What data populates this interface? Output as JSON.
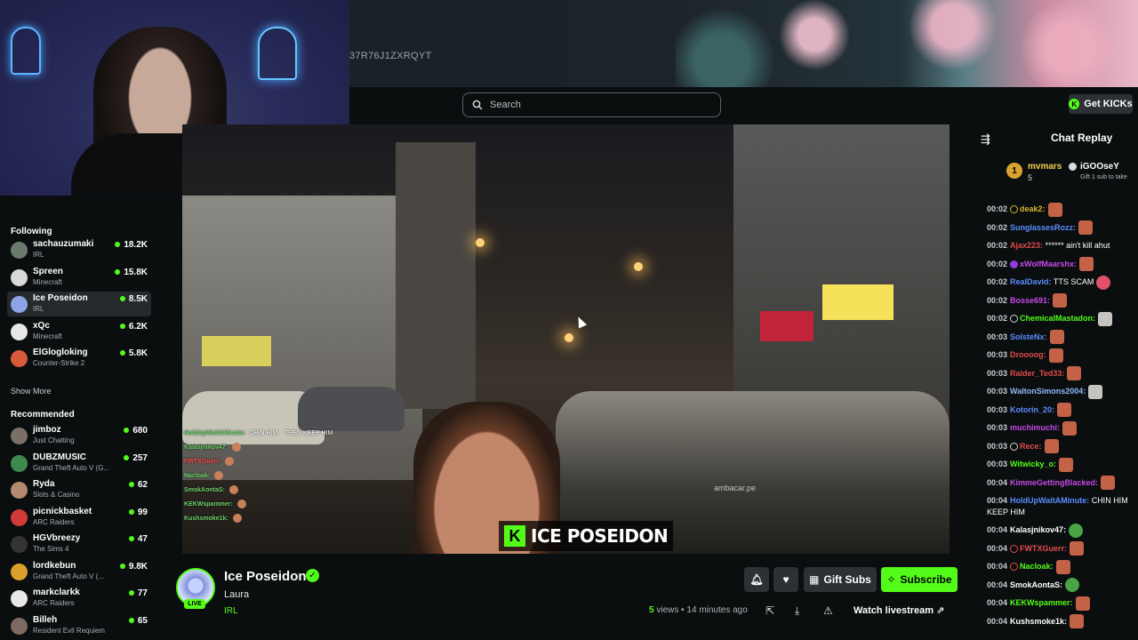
{
  "banner": {
    "code": "37R76J1ZXRQYT"
  },
  "header": {
    "search_placeholder": "Search",
    "get_kicks": "Get KICKs"
  },
  "sidebar": {
    "following_title": "Following",
    "following": [
      {
        "name": "sachauzumaki",
        "category": "IRL",
        "viewers": "18.2K",
        "avatar_color": "#6b7a6f"
      },
      {
        "name": "Spreen",
        "category": "Minecraft",
        "viewers": "15.8K",
        "avatar_color": "#d9d9d9"
      },
      {
        "name": "Ice Poseidon",
        "category": "IRL",
        "viewers": "8.5K",
        "avatar_color": "#8da4e8"
      },
      {
        "name": "xQc",
        "category": "Minecraft",
        "viewers": "6.2K",
        "avatar_color": "#e8e8e8"
      },
      {
        "name": "ElGlogloking",
        "category": "Counter-Strike 2",
        "viewers": "5.8K",
        "avatar_color": "#d85a3b"
      }
    ],
    "show_more": "Show More",
    "recommended_title": "Recommended",
    "recommended": [
      {
        "name": "jimboz",
        "category": "Just Chatting",
        "viewers": "680",
        "avatar_color": "#7a7068"
      },
      {
        "name": "DUBZMUSIC",
        "category": "Grand Theft Auto V (G...",
        "viewers": "257",
        "avatar_color": "#3e8a4e"
      },
      {
        "name": "Ryda",
        "category": "Slots & Casino",
        "viewers": "62",
        "avatar_color": "#b38a6d"
      },
      {
        "name": "picnickbasket",
        "category": "ARC Raiders",
        "viewers": "99",
        "avatar_color": "#d23a3a"
      },
      {
        "name": "HGVbreezy",
        "category": "The Sims 4",
        "viewers": "47",
        "avatar_color": "#333"
      },
      {
        "name": "lordkebun",
        "category": "Grand Theft Auto V (...",
        "viewers": "9.8K",
        "avatar_color": "#d9a12b"
      },
      {
        "name": "markclarkk",
        "category": "ARC Raiders",
        "viewers": "77",
        "avatar_color": "#e8e8e8"
      },
      {
        "name": "Billeh",
        "category": "Resident Evil Requiem",
        "viewers": "65",
        "avatar_color": "#7d6a60"
      }
    ]
  },
  "video": {
    "watermark": "ICE POSEIDON",
    "car_watermark": "ambacar.pe",
    "overlay_chat": [
      {
        "user": "HoldUpWaitAMinute:",
        "msg": "CHIN HIM",
        "extra_user": "",
        "extra_msg": "THEN KEEP HIM",
        "red": false
      },
      {
        "user": "Kalasjnikov47:",
        "msg": "",
        "red": false
      },
      {
        "user": "FWTXGuerr:",
        "msg": "",
        "red": true
      },
      {
        "user": "Nacloak:",
        "msg": "",
        "red": false
      },
      {
        "user": "SmokAontaS:",
        "msg": "",
        "red": false
      },
      {
        "user": "KEKWspammer:",
        "msg": "",
        "red": false
      },
      {
        "user": "Kushsmoke1k:",
        "msg": "",
        "red": false
      }
    ]
  },
  "info": {
    "channel_name": "Ice Poseidon",
    "live_badge": "LIVE",
    "title": "Laura",
    "category": "IRL",
    "gift_subs": "Gift Subs",
    "subscribe": "Subscribe",
    "views_count": "5",
    "views_label": "views",
    "age": "• 14 minutes ago",
    "watch_livestream": "Watch livestream"
  },
  "chat": {
    "title": "Chat Replay",
    "pinned": {
      "rank": "1",
      "user1": "mvmars",
      "count": "5",
      "user2": "iGOOseY",
      "gift_text": "Gift 1 sub to take"
    },
    "messages": [
      {
        "time": "00:02",
        "badge": "y",
        "user": "deak2:",
        "color": "#d8b42c",
        "text": "",
        "emote": "r"
      },
      {
        "time": "00:02",
        "badge": "",
        "user": "SunglassesRozz:",
        "color": "#5b8cff",
        "text": "",
        "emote": "r"
      },
      {
        "time": "00:02",
        "badge": "",
        "user": "Ajax223:",
        "color": "#e24a4a",
        "text": "****** ain't kill ahut",
        "emote": ""
      },
      {
        "time": "00:02",
        "badge": "p",
        "user": "xWolfMaarshx:",
        "color": "#c44be8",
        "text": "",
        "emote": "r"
      },
      {
        "time": "00:02",
        "badge": "",
        "user": "RealDavid:",
        "color": "#5b8cff",
        "text": "TTS SCAM",
        "emote": "pk"
      },
      {
        "time": "00:02",
        "badge": "",
        "user": "Bosse691:",
        "color": "#c44be8",
        "text": "",
        "emote": "r"
      },
      {
        "time": "00:02",
        "badge": "w",
        "user": "ChemicalMastadon:",
        "color": "#53fc18",
        "text": "",
        "emote": "c"
      },
      {
        "time": "00:03",
        "badge": "",
        "user": "SolsteNx:",
        "color": "#5b8cff",
        "text": "",
        "emote": "r"
      },
      {
        "time": "00:03",
        "badge": "",
        "user": "Droooog:",
        "color": "#e24a4a",
        "text": "",
        "emote": "r"
      },
      {
        "time": "00:03",
        "badge": "",
        "user": "Raider_Ted33:",
        "color": "#e24a4a",
        "text": "",
        "emote": "r"
      },
      {
        "time": "00:03",
        "badge": "",
        "user": "WaltonSimons2004:",
        "color": "#8fb8ff",
        "text": "",
        "emote": "c"
      },
      {
        "time": "00:03",
        "badge": "",
        "user": "Kotorin_20:",
        "color": "#5b8cff",
        "text": "",
        "emote": "r"
      },
      {
        "time": "00:03",
        "badge": "",
        "user": "muchimuchi:",
        "color": "#c44be8",
        "text": "",
        "emote": "r"
      },
      {
        "time": "00:03",
        "badge": "w",
        "user": "Rece:",
        "color": "#e24a4a",
        "text": "",
        "emote": "r"
      },
      {
        "time": "00:03",
        "badge": "",
        "user": "Witwicky_o:",
        "color": "#53fc18",
        "text": "",
        "emote": "r"
      },
      {
        "time": "00:04",
        "badge": "",
        "user": "KimmeGettingBlacked:",
        "color": "#c44be8",
        "text": "",
        "emote": "r"
      },
      {
        "time": "00:04",
        "badge": "",
        "user": "HoldUpWaitAMinute:",
        "color": "#5b8cff",
        "text": "CHIN HIM KEEP HIM",
        "emote": "",
        "wrap": true
      },
      {
        "time": "00:04",
        "badge": "",
        "user": "Kalasjnikov47:",
        "color": "#ffffff",
        "text": "",
        "emote": "g"
      },
      {
        "time": "00:04",
        "badge": "r",
        "user": "FWTXGuerr:",
        "color": "#e24a4a",
        "text": "",
        "emote": "r"
      },
      {
        "time": "00:04",
        "badge": "r",
        "user": "Nacloak:",
        "color": "#53fc18",
        "text": "",
        "emote": "r"
      },
      {
        "time": "00:04",
        "badge": "",
        "user": "SmokAontaS:",
        "color": "#ffffff",
        "text": "",
        "emote": "g"
      },
      {
        "time": "00:04",
        "badge": "",
        "user": "KEKWspammer:",
        "color": "#53fc18",
        "text": "",
        "emote": "r"
      },
      {
        "time": "00:04",
        "badge": "",
        "user": "Kushsmoke1k:",
        "color": "#ffffff",
        "text": "",
        "emote": "r"
      }
    ]
  },
  "colors": {
    "accent": "#53fc18",
    "background": "#0b0e0f",
    "button": "#2b3134"
  }
}
